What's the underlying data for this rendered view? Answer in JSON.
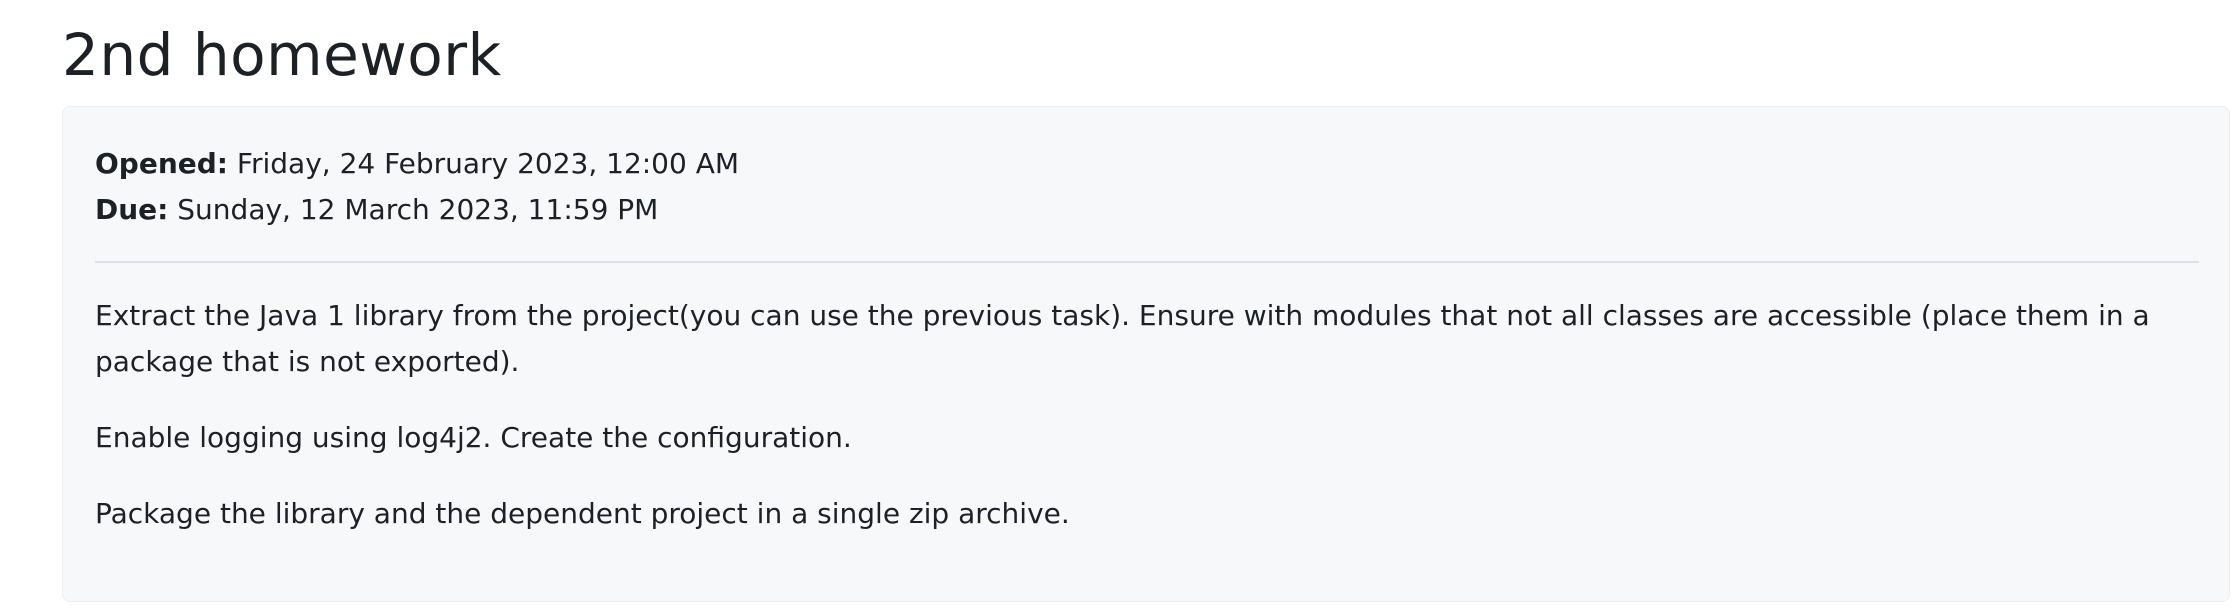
{
  "page": {
    "title": "2nd homework"
  },
  "dates": {
    "opened_label": "Opened:",
    "opened_value": " Friday, 24 February 2023, 12:00 AM",
    "due_label": "Due:",
    "due_value": " Sunday, 12 March 2023, 11:59 PM"
  },
  "description": {
    "paragraphs": [
      "Extract the Java 1 library from the project(you can use the previous task). Ensure with modules that not all classes are accessible (place them in a package that is not exported).",
      "Enable logging using log4j2. Create the configuration.",
      "Package the library and the dependent project in a single zip archive."
    ]
  },
  "colors": {
    "text": "#1d2125",
    "card_background": "#f7f8fa",
    "divider": "#dee2e6"
  }
}
